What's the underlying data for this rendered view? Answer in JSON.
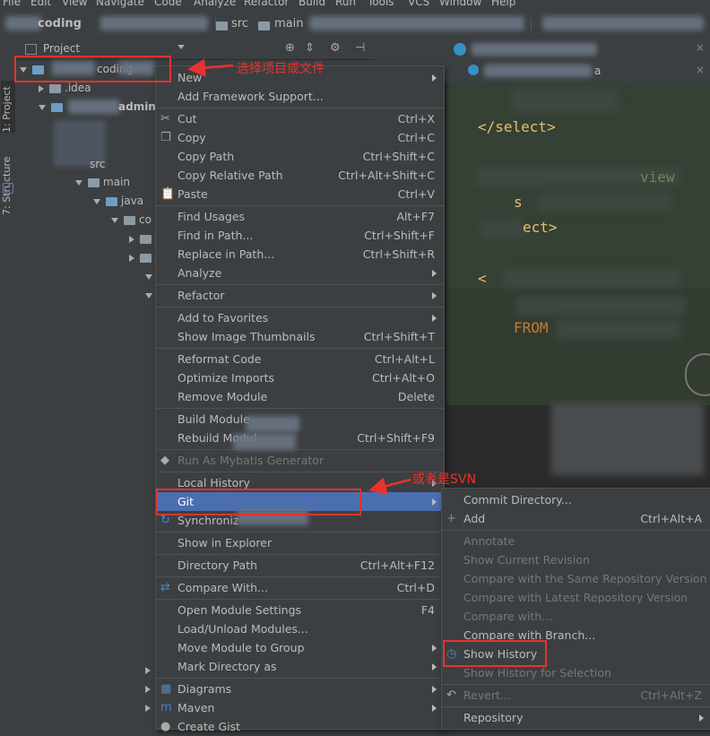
{
  "menubar": {
    "items": [
      "File",
      "Edit",
      "View",
      "Navigate",
      "Code",
      "Analyze",
      "Refactor",
      "Build",
      "Run",
      "Tools",
      "VCS",
      "Window",
      "Help"
    ]
  },
  "navbar": {
    "project_name": "coding",
    "crumb_src": "src",
    "crumb_main": "main"
  },
  "left_strip": {
    "project_tab": "1: Project",
    "structure_tab": "7: Structure"
  },
  "project_panel": {
    "header": "Project",
    "tree": [
      {
        "label": "coding",
        "level": 0,
        "expanded": true
      },
      {
        "label": ".idea",
        "level": 1,
        "expanded": false
      },
      {
        "label": "admin",
        "level": 1,
        "expanded": true
      },
      {
        "label": "src",
        "level": 2,
        "expanded": true
      },
      {
        "label": "main",
        "level": 3,
        "expanded": true
      },
      {
        "label": "java",
        "level": 4,
        "expanded": true
      },
      {
        "label": "co",
        "level": 5,
        "expanded": true
      }
    ]
  },
  "editor": {
    "tab_label": "a",
    "code_lines": [
      "</select>",
      "view",
      "s",
      "ect>",
      "<",
      "FROM"
    ]
  },
  "context_menu": {
    "items": [
      {
        "label": "New",
        "shortcut": "",
        "submenu": true
      },
      {
        "label": "Add Framework Support...",
        "shortcut": ""
      },
      {
        "sep": true
      },
      {
        "label": "Cut",
        "shortcut": "Ctrl+X",
        "icon": "scissors-icon"
      },
      {
        "label": "Copy",
        "shortcut": "Ctrl+C",
        "icon": "copy-icon"
      },
      {
        "label": "Copy Path",
        "shortcut": "Ctrl+Shift+C"
      },
      {
        "label": "Copy Relative Path",
        "shortcut": "Ctrl+Alt+Shift+C"
      },
      {
        "label": "Paste",
        "shortcut": "Ctrl+V",
        "icon": "paste-icon"
      },
      {
        "sep": true
      },
      {
        "label": "Find Usages",
        "shortcut": "Alt+F7"
      },
      {
        "label": "Find in Path...",
        "shortcut": "Ctrl+Shift+F"
      },
      {
        "label": "Replace in Path...",
        "shortcut": "Ctrl+Shift+R"
      },
      {
        "label": "Analyze",
        "shortcut": "",
        "submenu": true
      },
      {
        "sep": true
      },
      {
        "label": "Refactor",
        "shortcut": "",
        "submenu": true
      },
      {
        "sep": true
      },
      {
        "label": "Add to Favorites",
        "shortcut": "",
        "submenu": true
      },
      {
        "label": "Show Image Thumbnails",
        "shortcut": "Ctrl+Shift+T"
      },
      {
        "sep": true
      },
      {
        "label": "Reformat Code",
        "shortcut": "Ctrl+Alt+L"
      },
      {
        "label": "Optimize Imports",
        "shortcut": "Ctrl+Alt+O"
      },
      {
        "label": "Remove Module",
        "shortcut": "Delete"
      },
      {
        "sep": true
      },
      {
        "label": "Build Module",
        "shortcut": ""
      },
      {
        "label": "Rebuild Modul",
        "shortcut": "Ctrl+Shift+F9"
      },
      {
        "sep": true
      },
      {
        "label": "Run As Mybatis Generator",
        "shortcut": "",
        "disabled": true,
        "icon": "mybatis-icon"
      },
      {
        "sep": true
      },
      {
        "label": "Local History",
        "shortcut": "",
        "submenu": true
      },
      {
        "label": "Git",
        "shortcut": "",
        "submenu": true,
        "selected": true
      },
      {
        "label": "Synchroniz",
        "shortcut": "",
        "icon": "sync-icon"
      },
      {
        "sep": true
      },
      {
        "label": "Show in Explorer",
        "shortcut": ""
      },
      {
        "sep": true
      },
      {
        "label": "Directory Path",
        "shortcut": "Ctrl+Alt+F12"
      },
      {
        "sep": true
      },
      {
        "label": "Compare With...",
        "shortcut": "Ctrl+D",
        "icon": "compare-icon"
      },
      {
        "sep": true
      },
      {
        "label": "Open Module Settings",
        "shortcut": "F4"
      },
      {
        "label": "Load/Unload Modules...",
        "shortcut": ""
      },
      {
        "label": "Move Module to Group",
        "shortcut": "",
        "submenu": true
      },
      {
        "label": "Mark Directory as",
        "shortcut": "",
        "submenu": true
      },
      {
        "sep": true
      },
      {
        "label": "Diagrams",
        "shortcut": "",
        "submenu": true,
        "icon": "diagram-icon"
      },
      {
        "label": "Maven",
        "shortcut": "",
        "submenu": true,
        "icon": "maven-icon"
      },
      {
        "label": "Create Gist",
        "shortcut": "",
        "icon": "github-icon"
      }
    ]
  },
  "git_submenu": {
    "items": [
      {
        "label": "Commit Directory...",
        "shortcut": ""
      },
      {
        "label": "Add",
        "shortcut": "Ctrl+Alt+A",
        "icon": "plus-icon"
      },
      {
        "sep": true
      },
      {
        "label": "Annotate",
        "shortcut": "",
        "disabled": true
      },
      {
        "label": "Show Current Revision",
        "shortcut": "",
        "disabled": true
      },
      {
        "label": "Compare with the Same Repository Version",
        "shortcut": "",
        "disabled": true
      },
      {
        "label": "Compare with Latest Repository Version",
        "shortcut": "",
        "disabled": true
      },
      {
        "label": "Compare with...",
        "shortcut": "",
        "disabled": true
      },
      {
        "label": "Compare with Branch...",
        "shortcut": ""
      },
      {
        "label": "Show History",
        "shortcut": "",
        "icon": "history-icon"
      },
      {
        "label": "Show History for Selection",
        "shortcut": "",
        "disabled": true
      },
      {
        "sep": true
      },
      {
        "label": "Revert...",
        "shortcut": "Ctrl+Alt+Z",
        "disabled": true,
        "icon": "revert-icon"
      },
      {
        "sep": true
      },
      {
        "label": "Repository",
        "shortcut": "",
        "submenu": true
      }
    ]
  },
  "annotations": {
    "select_project": "选择项目或文件",
    "or_svn": "或者是SVN"
  },
  "colors": {
    "selection": "#4b6eaf",
    "annotation_red": "#e8322f",
    "menu_bg": "#3c3f41",
    "editor_bg": "#2b2b2b"
  }
}
